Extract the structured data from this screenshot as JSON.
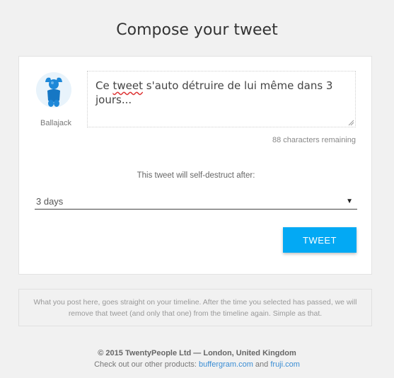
{
  "page": {
    "title": "Compose your tweet"
  },
  "user": {
    "name": "Ballajack",
    "avatar_icon": "blue-figure-avatar-icon"
  },
  "composer": {
    "text_part1": "Ce ",
    "text_err": "tweet",
    "text_part2": " s'auto détruire de lui même dans 3 jours...",
    "counter": "88 characters remaining"
  },
  "destruct": {
    "label": "This tweet will self-destruct after:",
    "selected": "3 days"
  },
  "actions": {
    "tweet_label": "TWEET",
    "tweet_color": "#03a9f4"
  },
  "info": {
    "text": "What you post here, goes straight on your timeline. After the time you selected has passed, we will remove that tweet (and only that one) from the timeline again. Simple as that."
  },
  "footer": {
    "copyright": "© 2015 TwentyPeople Ltd — London, United Kingdom",
    "products_prefix": "Check out our other products: ",
    "link1": "buffergram.com",
    "joiner": " and ",
    "link2": "fruji.com"
  }
}
